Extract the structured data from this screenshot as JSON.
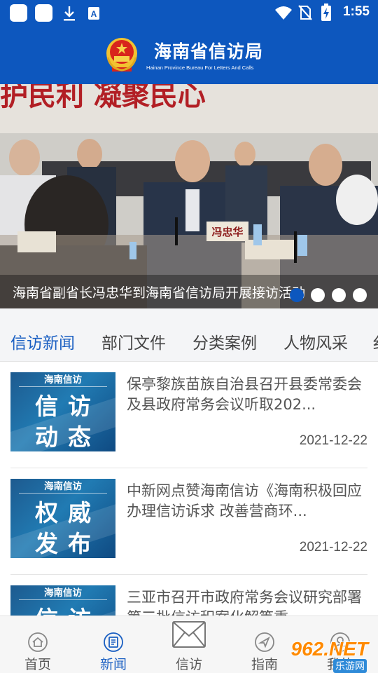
{
  "status_bar": {
    "time": "1:55",
    "icons": [
      "app-icon",
      "app-icon",
      "download-icon",
      "text-icon",
      "wifi-icon",
      "no-sim-icon",
      "battery-charging-icon"
    ]
  },
  "header": {
    "title": "海南省信访局",
    "subtitle": "Hainan Province Bureau For Letters And Calls",
    "color": "#0d57be"
  },
  "banner": {
    "caption": "海南省副省长冯忠华到海南省信访局开展接访活动",
    "backdrop_text": "护民利    凝聚民心",
    "nameplate": "冯忠华",
    "slide_count": 4,
    "active_slide": 0
  },
  "tabs": [
    {
      "label": "信访新闻",
      "active": true
    },
    {
      "label": "部门文件",
      "active": false
    },
    {
      "label": "分类案例",
      "active": false
    },
    {
      "label": "人物风采",
      "active": false
    },
    {
      "label": "纟",
      "active": false
    }
  ],
  "news": [
    {
      "thumb_top": "海南信访",
      "thumb_line1": "信访",
      "thumb_line2": "动态",
      "title": "保亭黎族苗族自治县召开县委常委会及县政府常务会议听取202...",
      "date": "2021-12-22"
    },
    {
      "thumb_top": "海南信访",
      "thumb_line1": "权威",
      "thumb_line2": "发布",
      "title": "中新网点赞海南信访《海南积极回应办理信访诉求 改善营商环...",
      "date": "2021-12-22"
    },
    {
      "thumb_top": "海南信访",
      "thumb_line1": "信访",
      "thumb_line2": "",
      "title": "三亚市召开市政府常务会议研究部署第三批信访积案化解等重...",
      "date": ""
    }
  ],
  "bottom_nav": [
    {
      "label": "首页",
      "icon": "home-icon",
      "active": false
    },
    {
      "label": "新闻",
      "icon": "news-icon",
      "active": true
    },
    {
      "label": "信访",
      "icon": "envelope-icon",
      "active": false
    },
    {
      "label": "指南",
      "icon": "compass-icon",
      "active": false
    },
    {
      "label": "我的",
      "icon": "profile-icon",
      "active": false
    }
  ],
  "watermark": {
    "text": "962.NET",
    "sub": "乐游网"
  },
  "colors": {
    "accent": "#1a5fc2",
    "thumb": "#217bb3"
  }
}
